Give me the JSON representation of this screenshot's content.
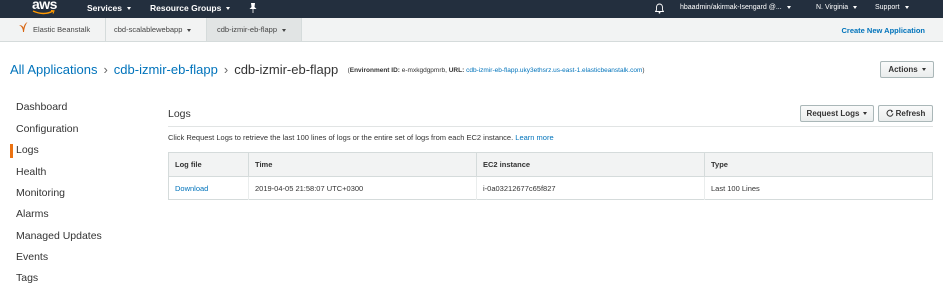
{
  "topnav": {
    "logo": "aws",
    "services": "Services",
    "resource_groups": "Resource Groups",
    "account": "hbaadmin/akirmak-Isengard @...",
    "region": "N. Virginia",
    "support": "Support"
  },
  "subnav": {
    "service": "Elastic Beanstalk",
    "application": "cbd-scalablewebapp",
    "environment": "cdb-izmir-eb-flapp",
    "create": "Create New Application"
  },
  "header": {
    "all_apps": "All Applications",
    "app": "cdb-izmir-eb-flapp",
    "env": "cdb-izmir-eb-flapp",
    "env_id_label": "Environment ID:",
    "env_id": "e-mxkgdgpmrb,",
    "url_label": "URL:",
    "url": "cdb-izmir-eb-flapp.uky3ethsrz.us-east-1.elasticbeanstalk.com",
    "actions": "Actions"
  },
  "sidebar": {
    "items": [
      {
        "label": "Dashboard"
      },
      {
        "label": "Configuration"
      },
      {
        "label": "Logs"
      },
      {
        "label": "Health"
      },
      {
        "label": "Monitoring"
      },
      {
        "label": "Alarms"
      },
      {
        "label": "Managed Updates"
      },
      {
        "label": "Events"
      },
      {
        "label": "Tags"
      }
    ]
  },
  "logs": {
    "title": "Logs",
    "request_logs": "Request Logs",
    "refresh": "Refresh",
    "description": "Click Request Logs to retrieve the last 100 lines of logs or the entire set of logs from each EC2 instance.",
    "learn_more": "Learn more",
    "columns": [
      "Log file",
      "Time",
      "EC2 instance",
      "Type"
    ],
    "rows": [
      [
        "Download",
        "2019-04-05 21:58:07 UTC+0300",
        "i-0a03212677c65f827",
        "Last 100 Lines"
      ]
    ]
  },
  "colors": {
    "nav_bg": "#232f3e",
    "link": "#0073bb",
    "accent": "#ec7211"
  },
  "icons": [
    "aws-logo",
    "pin-icon",
    "bell-icon",
    "beanstalk-icon",
    "refresh-icon"
  ]
}
